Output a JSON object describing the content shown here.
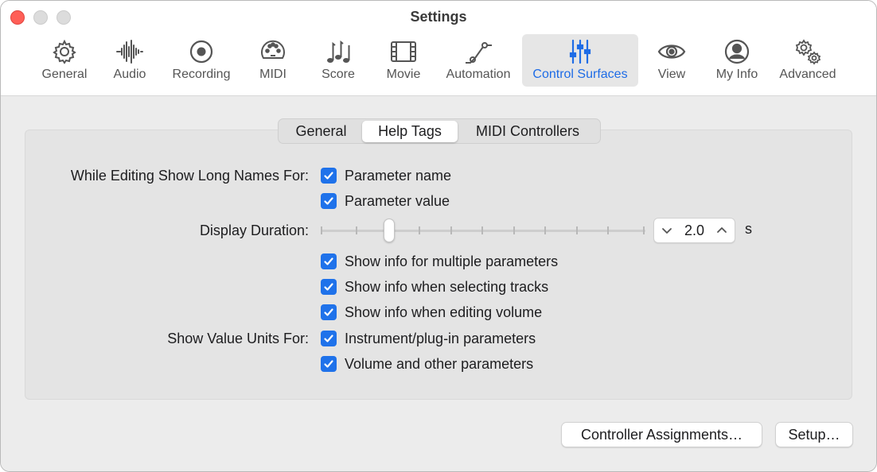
{
  "window": {
    "title": "Settings"
  },
  "toolbar": {
    "items": [
      {
        "label": "General",
        "icon": "gear-icon"
      },
      {
        "label": "Audio",
        "icon": "waveform-icon"
      },
      {
        "label": "Recording",
        "icon": "record-icon"
      },
      {
        "label": "MIDI",
        "icon": "midi-icon"
      },
      {
        "label": "Score",
        "icon": "music-notes-icon"
      },
      {
        "label": "Movie",
        "icon": "film-icon"
      },
      {
        "label": "Automation",
        "icon": "automation-curve-icon"
      },
      {
        "label": "Control Surfaces",
        "icon": "sliders-icon"
      },
      {
        "label": "View",
        "icon": "eye-icon"
      },
      {
        "label": "My Info",
        "icon": "person-icon"
      },
      {
        "label": "Advanced",
        "icon": "gears-icon"
      }
    ],
    "active": "Control Surfaces"
  },
  "tabs": {
    "items": [
      "General",
      "Help Tags",
      "MIDI Controllers"
    ],
    "selected": "Help Tags"
  },
  "form": {
    "long_names_label": "While Editing Show Long Names For:",
    "param_name": "Parameter name",
    "param_value": "Parameter value",
    "duration_label": "Display Duration:",
    "duration_value": "2.0",
    "duration_unit": "s",
    "duration_slider_fraction": 0.2,
    "multi_params": "Show info for multiple parameters",
    "selecting_tracks": "Show info when selecting tracks",
    "editing_volume": "Show info when editing volume",
    "value_units_label": "Show Value Units For:",
    "instrument_params": "Instrument/plug-in parameters",
    "volume_params": "Volume and other parameters"
  },
  "buttons": {
    "controller_assignments": "Controller Assignments…",
    "setup": "Setup…"
  },
  "colors": {
    "accent": "#1e6ce6",
    "checkbox": "#1f72ea",
    "close": "#ff5f57"
  }
}
